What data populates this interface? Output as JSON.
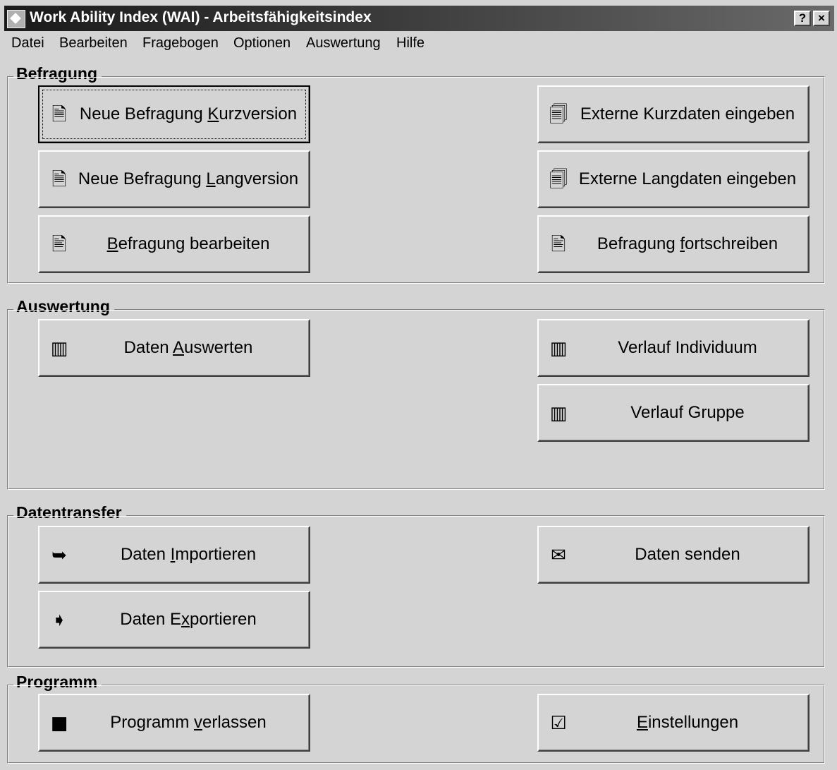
{
  "window": {
    "title": "Work Ability Index (WAI) - Arbeitsfähigkeitsindex",
    "help_btn": "?",
    "close_btn": "×"
  },
  "menu": [
    "Datei",
    "Bearbeiten",
    "Fragebogen",
    "Optionen",
    "Auswertung",
    "Hilfe"
  ],
  "groups": {
    "befragung": {
      "label": "Befragung",
      "kurz": {
        "pre": "Neue Befragung ",
        "u": "K",
        "post": "urzversion"
      },
      "lang": {
        "pre": "Neue Befragung ",
        "u": "L",
        "post": "angversion"
      },
      "bearbeiten": {
        "pre": "",
        "u": "B",
        "post": "efragung bearbeiten"
      },
      "ext_kurz": {
        "pre": "Externe Kurzdaten eingeben",
        "u": "",
        "post": ""
      },
      "ext_lang": {
        "pre": "Externe Langdaten eingeben",
        "u": "",
        "post": ""
      },
      "fortschreiben": {
        "pre": "Befragung ",
        "u": "f",
        "post": "ortschreiben"
      }
    },
    "auswertung": {
      "label": "Auswertung",
      "daten": {
        "pre": "Daten ",
        "u": "A",
        "post": "uswerten"
      },
      "individuum": {
        "pre": "Verlauf Individuum",
        "u": "",
        "post": ""
      },
      "gruppe": {
        "pre": "Verlauf Gruppe",
        "u": "",
        "post": ""
      }
    },
    "datentransfer": {
      "label": "Datentransfer",
      "import": {
        "pre": "Daten ",
        "u": "I",
        "post": "mportieren"
      },
      "export": {
        "pre": "Daten E",
        "u": "x",
        "post": "portieren"
      },
      "senden": {
        "pre": "Daten senden",
        "u": "",
        "post": ""
      }
    },
    "programm": {
      "label": "Programm",
      "verlassen": {
        "pre": "Programm ",
        "u": "v",
        "post": "erlassen"
      },
      "einstellungen": {
        "pre": "",
        "u": "E",
        "post": "instellungen"
      }
    }
  },
  "icons": {
    "new_doc": "🗎",
    "external": "🗐",
    "edit": "🖹",
    "chart": "▥",
    "import": "➥",
    "export": "➧",
    "mail": "✉",
    "exit": "■",
    "settings": "☑"
  }
}
